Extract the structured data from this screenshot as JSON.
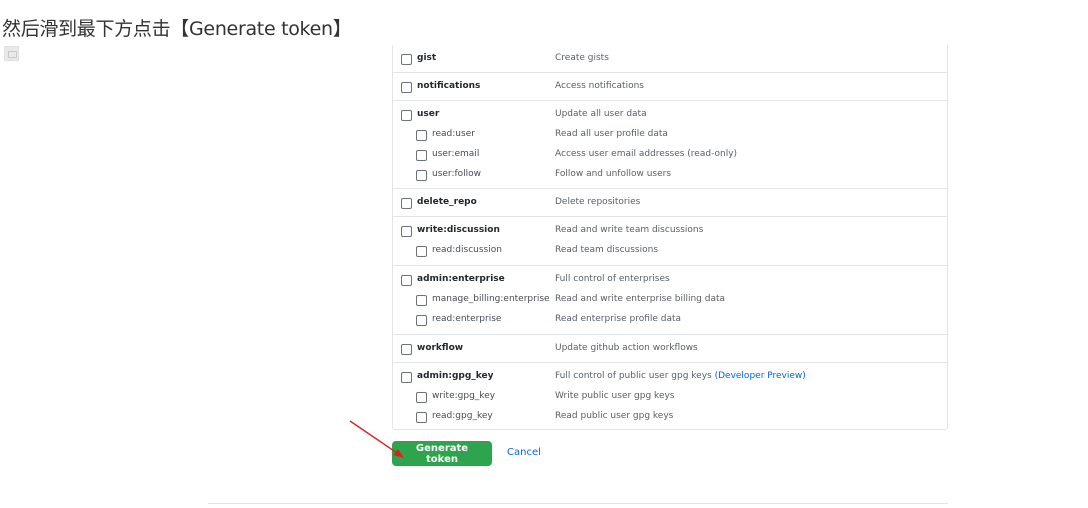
{
  "caption": "然后滑到最下方点击【Generate token】",
  "scopes": [
    {
      "name": "gist",
      "desc": "Create gists",
      "subs": []
    },
    {
      "name": "notifications",
      "desc": "Access notifications",
      "subs": []
    },
    {
      "name": "user",
      "desc": "Update all user data",
      "subs": [
        {
          "name": "read:user",
          "desc": "Read all user profile data"
        },
        {
          "name": "user:email",
          "desc": "Access user email addresses (read-only)"
        },
        {
          "name": "user:follow",
          "desc": "Follow and unfollow users"
        }
      ]
    },
    {
      "name": "delete_repo",
      "desc": "Delete repositories",
      "subs": []
    },
    {
      "name": "write:discussion",
      "desc": "Read and write team discussions",
      "subs": [
        {
          "name": "read:discussion",
          "desc": "Read team discussions"
        }
      ]
    },
    {
      "name": "admin:enterprise",
      "desc": "Full control of enterprises",
      "subs": [
        {
          "name": "manage_billing:enterprise",
          "desc": "Read and write enterprise billing data"
        },
        {
          "name": "read:enterprise",
          "desc": "Read enterprise profile data"
        }
      ]
    },
    {
      "name": "workflow",
      "desc": "Update github action workflows",
      "subs": []
    },
    {
      "name": "admin:gpg_key",
      "desc": "Full control of public user gpg keys",
      "desc_link": "(Developer Preview)",
      "subs": [
        {
          "name": "write:gpg_key",
          "desc": "Write public user gpg keys"
        },
        {
          "name": "read:gpg_key",
          "desc": "Read public user gpg keys"
        }
      ]
    }
  ],
  "actions": {
    "generate_label": "Generate token",
    "cancel_label": "Cancel"
  },
  "colors": {
    "primary_button": "#2ea44f",
    "link": "#0366d6",
    "annotation_arrow": "#e02020"
  }
}
